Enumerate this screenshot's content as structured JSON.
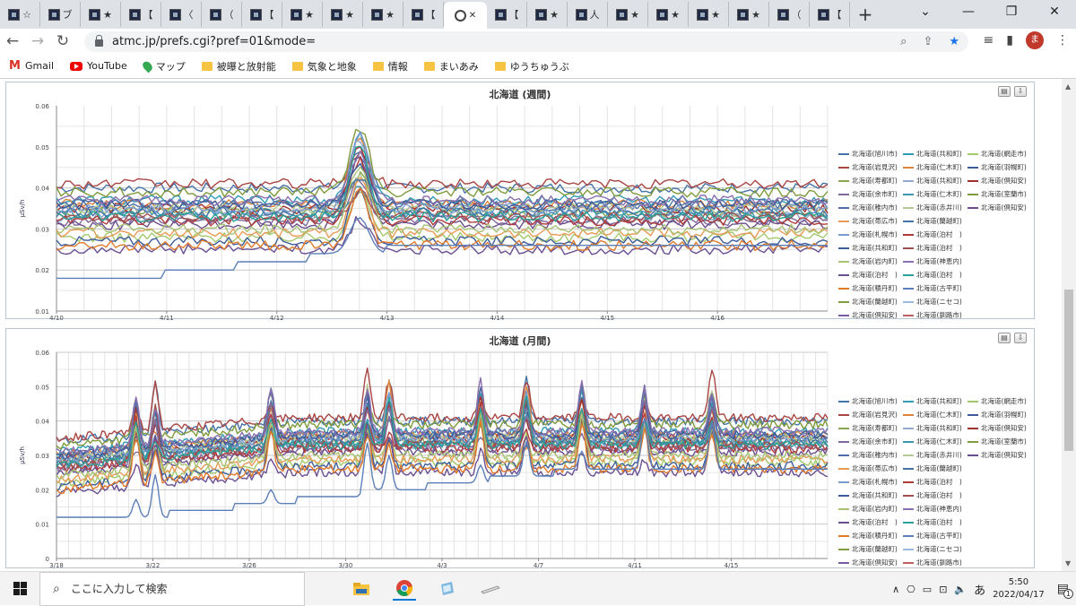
{
  "browser": {
    "tabs": [
      {
        "glyph": "☆",
        "icon": "site-favicon"
      },
      {
        "glyph": "ブ",
        "icon": "circle-i-icon"
      },
      {
        "glyph": "★",
        "icon": "site-favicon"
      },
      {
        "glyph": "【",
        "icon": "site-favicon"
      },
      {
        "glyph": "〈",
        "icon": "site-favicon"
      },
      {
        "glyph": "（",
        "icon": "site-favicon"
      },
      {
        "glyph": "【",
        "icon": "site-favicon"
      },
      {
        "glyph": "★",
        "icon": "site-favicon"
      },
      {
        "glyph": "★",
        "icon": "site-favicon"
      },
      {
        "glyph": "★",
        "icon": "site-favicon"
      },
      {
        "glyph": "【",
        "icon": "site-favicon"
      }
    ],
    "active_tab": {
      "icon": "globe-icon",
      "close": "✕"
    },
    "tabs_after": [
      {
        "glyph": "【",
        "icon": "site-favicon"
      },
      {
        "glyph": "★",
        "icon": "site-favicon"
      },
      {
        "glyph": "人",
        "icon": "site-favicon"
      },
      {
        "glyph": "★",
        "icon": "site-favicon"
      },
      {
        "glyph": "★",
        "icon": "site-favicon"
      },
      {
        "glyph": "★",
        "icon": "site-favicon"
      },
      {
        "glyph": "★",
        "icon": "site-favicon"
      },
      {
        "glyph": "（",
        "icon": "site-favicon"
      },
      {
        "glyph": "【",
        "icon": "site-favicon"
      }
    ],
    "new_tab": "+",
    "window_controls": {
      "tabsearch": "⌄",
      "minimize": "—",
      "maximize": "❐",
      "close": "✕"
    },
    "url": "atmc.jp/prefs.cgi?pref=01&mode=",
    "avatar_letter": "ま",
    "bookmarks": [
      {
        "label": "Gmail",
        "icon": "gmail-icon"
      },
      {
        "label": "YouTube",
        "icon": "youtube-icon"
      },
      {
        "label": "マップ",
        "icon": "maps-icon"
      },
      {
        "label": "被曝と放射能",
        "icon": "folder-icon"
      },
      {
        "label": "気象と地象",
        "icon": "folder-icon"
      },
      {
        "label": "情報",
        "icon": "folder-icon"
      },
      {
        "label": "まいあみ",
        "icon": "folder-icon"
      },
      {
        "label": "ゆうちゅうぶ",
        "icon": "folder-icon"
      }
    ]
  },
  "panel_buttons": {
    "print": "▤",
    "download": "⇩"
  },
  "legend": [
    {
      "name": "北海道(旭川市)",
      "color": "#4572a7"
    },
    {
      "name": "北海道(共和町)",
      "color": "#2f9bb3"
    },
    {
      "name": "北海道(網走市)",
      "color": "#a4c96c"
    },
    {
      "name": "北海道(岩見沢)",
      "color": "#aa4643"
    },
    {
      "name": "北海道(仁木町)",
      "color": "#db843d"
    },
    {
      "name": "北海道(羽幌町)",
      "color": "#3d5c99"
    },
    {
      "name": "北海道(寿都町)",
      "color": "#89a54e"
    },
    {
      "name": "北海道(共和町)",
      "color": "#92a8cd"
    },
    {
      "name": "北海道(倶知安)",
      "color": "#a03030"
    },
    {
      "name": "北海道(余市町)",
      "color": "#80699b"
    },
    {
      "name": "北海道(仁木町)",
      "color": "#3d96ae"
    },
    {
      "name": "北海道(室蘭市)",
      "color": "#7f9a3a"
    },
    {
      "name": "北海道(稚内市)",
      "color": "#4e6ea8"
    },
    {
      "name": "北海道(赤井川)",
      "color": "#b5ca92"
    },
    {
      "name": "北海道(倶知安)",
      "color": "#6b4f8c"
    },
    {
      "name": "北海道(帯広市)",
      "color": "#e89a55"
    },
    {
      "name": "北海道(蘭越町)",
      "color": "#4572a7"
    },
    {
      "name": "",
      "color": ""
    },
    {
      "name": "北海道(札幌市)",
      "color": "#7b9bd0"
    },
    {
      "name": "北海道(泊村　)",
      "color": "#b03a3a"
    },
    {
      "name": "",
      "color": ""
    },
    {
      "name": "北海道(共和町)",
      "color": "#3d5c99"
    },
    {
      "name": "北海道(泊村　)",
      "color": "#a05050"
    },
    {
      "name": "",
      "color": ""
    },
    {
      "name": "北海道(岩内町)",
      "color": "#a7c373"
    },
    {
      "name": "北海道(神恵内)",
      "color": "#8a6fae"
    },
    {
      "name": "",
      "color": ""
    },
    {
      "name": "北海道(泊村　)",
      "color": "#6a4f93"
    },
    {
      "name": "北海道(泊村　)",
      "color": "#2aa198"
    },
    {
      "name": "",
      "color": ""
    },
    {
      "name": "北海道(積丹町)",
      "color": "#e07b2a"
    },
    {
      "name": "北海道(古平町)",
      "color": "#5c7fb8"
    },
    {
      "name": "",
      "color": ""
    },
    {
      "name": "北海道(蘭越町)",
      "color": "#7d9d3f"
    },
    {
      "name": "北海道(ニセコ)",
      "color": "#9fb8de"
    },
    {
      "name": "",
      "color": ""
    },
    {
      "name": "北海道(倶知安)",
      "color": "#7a5a9e"
    },
    {
      "name": "北海道(釧路市)",
      "color": "#c06060"
    }
  ],
  "charts": {
    "weekly": {
      "title": "北海道 (週間)",
      "ylabel": "μSv/h",
      "yticks": [
        "0.01",
        "0.02",
        "0.03",
        "0.04",
        "0.05",
        "0.06"
      ],
      "xticks": [
        "4/10",
        "4/11",
        "4/12",
        "4/13",
        "4/14",
        "4/15",
        "4/16"
      ]
    },
    "monthly": {
      "title": "北海道 (月間)",
      "ylabel": "μSv/h",
      "yticks": [
        "0",
        "0.01",
        "0.02",
        "0.03",
        "0.04",
        "0.05",
        "0.06"
      ],
      "xticks": [
        "3/18",
        "3/22",
        "3/26",
        "3/30",
        "4/3",
        "4/7",
        "4/11",
        "4/15"
      ]
    }
  },
  "chart_data": [
    {
      "type": "line",
      "title": "北海道 (週間)",
      "xlabel": "",
      "ylabel": "μSv/h",
      "ylim": [
        0.01,
        0.06
      ],
      "x": [
        "4/10",
        "4/11",
        "4/12",
        "4/13",
        "4/14",
        "4/15",
        "4/16"
      ],
      "grid": true,
      "legend_position": "right",
      "series_baselines": [
        0.04,
        0.037,
        0.028,
        0.041,
        0.036,
        0.027,
        0.034,
        0.033,
        0.035,
        0.032,
        0.034,
        0.039,
        0.036,
        0.035,
        0.031,
        0.029,
        0.034,
        0.035,
        0.032,
        0.036,
        0.033,
        0.03,
        0.037,
        0.025,
        0.033,
        0.026,
        0.024
      ],
      "spike_day": "4/12",
      "spike_peak": 0.055,
      "min_series": {
        "start": 0.017,
        "end": 0.026
      }
    },
    {
      "type": "line",
      "title": "北海道 (月間)",
      "xlabel": "",
      "ylabel": "μSv/h",
      "ylim": [
        0,
        0.06
      ],
      "x": [
        "3/18",
        "3/22",
        "3/26",
        "3/30",
        "4/3",
        "4/7",
        "4/11",
        "4/15"
      ],
      "grid": true,
      "legend_position": "right",
      "series_baselines": [
        0.04,
        0.037,
        0.028,
        0.041,
        0.036,
        0.027,
        0.034,
        0.033,
        0.035,
        0.032,
        0.034,
        0.039,
        0.036,
        0.035,
        0.031,
        0.029,
        0.034,
        0.035,
        0.032,
        0.036,
        0.033,
        0.03,
        0.037,
        0.025,
        0.033,
        0.026,
        0.024
      ],
      "spike_days": [
        "3/21",
        "3/22",
        "3/27",
        "3/31",
        "4/1",
        "4/7",
        "4/9",
        "4/12"
      ],
      "spike_peak": 0.052,
      "min_series": {
        "start": 0.011,
        "end": 0.026
      }
    }
  ],
  "taskbar": {
    "search_placeholder": "ここに入力して検索",
    "time": "5:50",
    "date": "2022/04/17",
    "ime": "あ",
    "notif_count": "1"
  }
}
